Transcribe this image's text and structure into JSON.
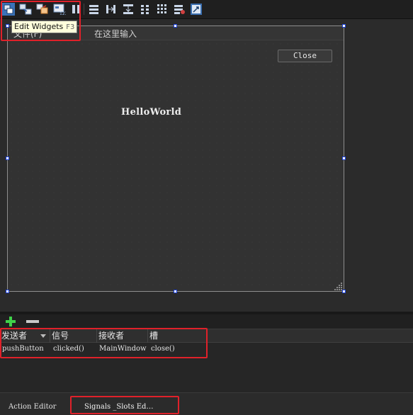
{
  "tooltip": {
    "text": "Edit Widgets",
    "shortcut": "F3"
  },
  "toolbar": {
    "icons": [
      "edit-widgets-icon",
      "edit-signals-slots-icon",
      "edit-buddies-icon",
      "edit-tab-order-icon",
      "layout-horizontally-icon",
      "layout-vertically-icon",
      "layout-horizontal-splitter-icon",
      "layout-vertical-splitter-icon",
      "layout-form-icon",
      "layout-grid-icon",
      "break-layout-icon",
      "adjust-size-icon"
    ]
  },
  "form": {
    "menubar": {
      "items": [
        "文件(F)",
        "在这里输入"
      ]
    },
    "close_button": "Close",
    "label": "HelloWorld"
  },
  "connections": {
    "columns": [
      "发送者",
      "信号",
      "接收者",
      "槽"
    ],
    "rows": [
      {
        "sender": "pushButton",
        "signal": "clicked()",
        "receiver": "MainWindow",
        "slot": "close()"
      }
    ]
  },
  "tabs": {
    "action_editor": "Action Editor",
    "signals_slots": "Signals _Slots Ed…"
  },
  "colors": {
    "annotation": "#e0212a",
    "handle_border": "#1a3fd6",
    "add": "#3fd24a",
    "background": "#2b2b2b"
  }
}
